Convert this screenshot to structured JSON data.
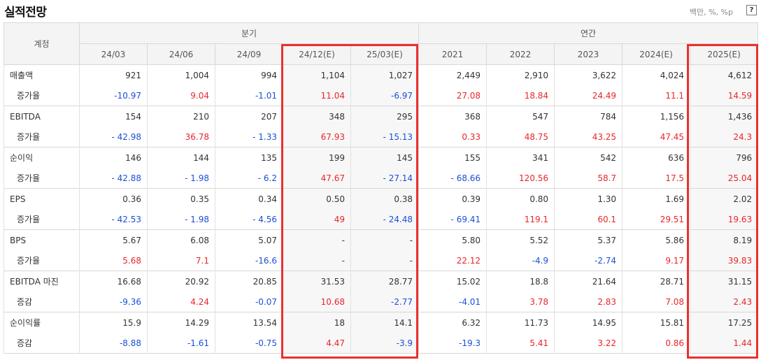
{
  "title": "실적전망",
  "unit": "백만, %, %p",
  "help": "?",
  "header": {
    "account": "계정",
    "quarterly": "분기",
    "annual": "연간",
    "periods": [
      "24/03",
      "24/06",
      "24/09",
      "24/12(E)",
      "25/03(E)",
      "2021",
      "2022",
      "2023",
      "2024(E)",
      "2025(E)"
    ]
  },
  "rows": [
    {
      "label": "매출액",
      "values": [
        "921",
        "1,004",
        "994",
        "1,104",
        "1,027",
        "2,449",
        "2,910",
        "3,622",
        "4,024",
        "4,612"
      ]
    },
    {
      "label": "증가율",
      "values": [
        "-10.97",
        "9.04",
        "-1.01",
        "11.04",
        "-6.97",
        "27.08",
        "18.84",
        "24.49",
        "11.1",
        "14.59"
      ]
    },
    {
      "label": "EBITDA",
      "values": [
        "154",
        "210",
        "207",
        "348",
        "295",
        "368",
        "547",
        "784",
        "1,156",
        "1,436"
      ]
    },
    {
      "label": "증가율",
      "values": [
        "- 42.98",
        "36.78",
        "- 1.33",
        "67.93",
        "- 15.13",
        "0.33",
        "48.75",
        "43.25",
        "47.45",
        "24.3"
      ]
    },
    {
      "label": "순이익",
      "values": [
        "146",
        "144",
        "135",
        "199",
        "145",
        "155",
        "341",
        "542",
        "636",
        "796"
      ]
    },
    {
      "label": "증가율",
      "values": [
        "- 42.88",
        "- 1.98",
        "- 6.2",
        "47.67",
        "- 27.14",
        "- 68.66",
        "120.56",
        "58.7",
        "17.5",
        "25.04"
      ]
    },
    {
      "label": "EPS",
      "values": [
        "0.36",
        "0.35",
        "0.34",
        "0.50",
        "0.38",
        "0.39",
        "0.80",
        "1.30",
        "1.69",
        "2.02"
      ]
    },
    {
      "label": "증가율",
      "values": [
        "- 42.53",
        "- 1.98",
        "- 4.56",
        "49",
        "- 24.48",
        "- 69.41",
        "119.1",
        "60.1",
        "29.51",
        "19.63"
      ]
    },
    {
      "label": "BPS",
      "values": [
        "5.67",
        "6.08",
        "5.07",
        "-",
        "-",
        "5.80",
        "5.52",
        "5.37",
        "5.86",
        "8.19"
      ]
    },
    {
      "label": "증가율",
      "values": [
        "5.68",
        "7.1",
        "-16.6",
        "-",
        "-",
        "22.12",
        "-4.9",
        "-2.74",
        "9.17",
        "39.83"
      ]
    },
    {
      "label": "EBITDA 마진",
      "values": [
        "16.68",
        "20.92",
        "20.85",
        "31.53",
        "28.77",
        "15.02",
        "18.8",
        "21.64",
        "28.71",
        "31.15"
      ]
    },
    {
      "label": "증감",
      "values": [
        "-9.36",
        "4.24",
        "-0.07",
        "10.68",
        "-2.77",
        "-4.01",
        "3.78",
        "2.83",
        "7.08",
        "2.43"
      ]
    },
    {
      "label": "순이익률",
      "values": [
        "15.9",
        "14.29",
        "13.54",
        "18",
        "14.1",
        "6.32",
        "11.73",
        "14.95",
        "15.81",
        "17.25"
      ]
    },
    {
      "label": "증감",
      "values": [
        "-8.88",
        "-1.61",
        "-0.75",
        "4.47",
        "-3.9",
        "-19.3",
        "5.41",
        "3.22",
        "0.86",
        "1.44"
      ]
    }
  ],
  "colors": {
    "up": "#e8262b",
    "down": "#1a4fd6",
    "highlight": "#e8312f"
  }
}
